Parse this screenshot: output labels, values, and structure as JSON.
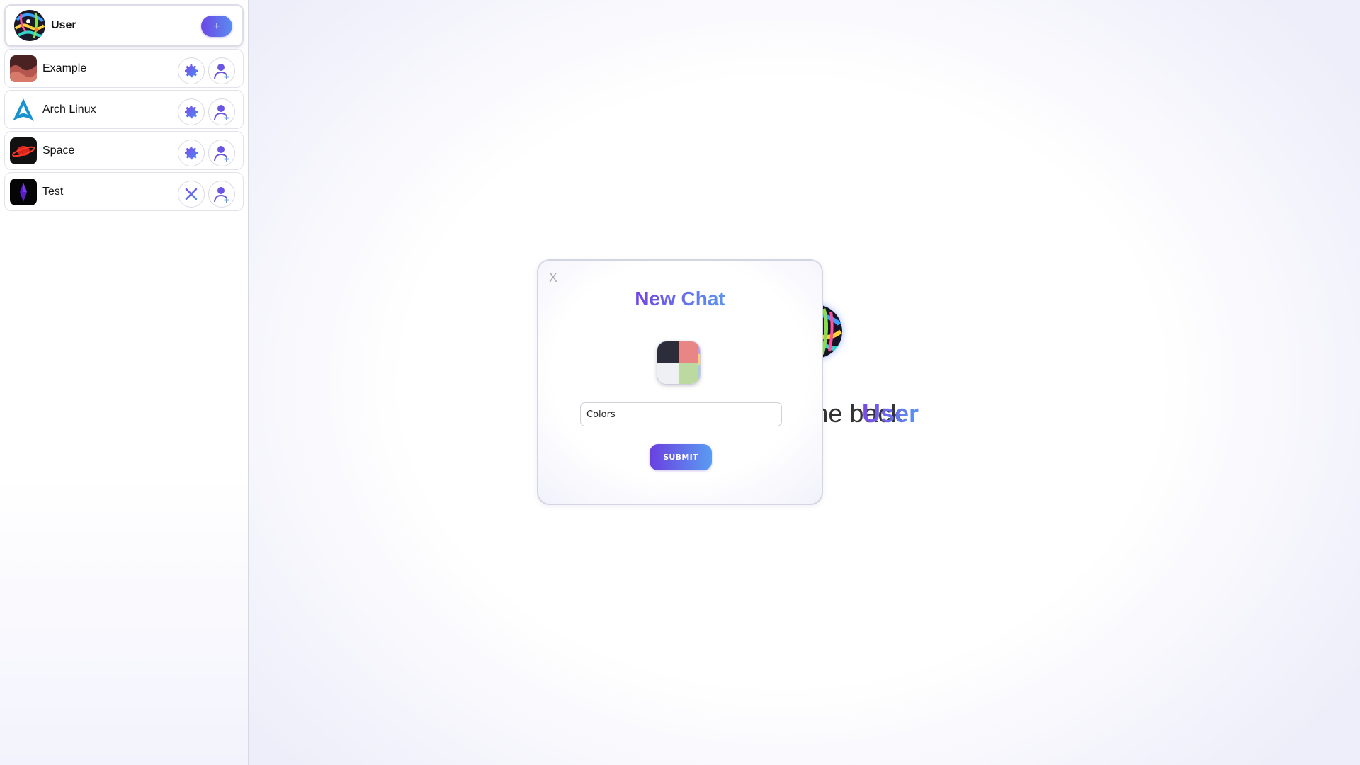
{
  "sidebar": {
    "user": {
      "name": "User",
      "add_label": "+",
      "avatar_icon": "user-avatar"
    },
    "chats": [
      {
        "name": "Example",
        "icon": "example-chat-icon",
        "action_a": "gear-icon",
        "action_b": "user-plus-icon"
      },
      {
        "name": "Arch Linux",
        "icon": "arch-linux-chat-icon",
        "action_a": "gear-icon",
        "action_b": "user-plus-icon"
      },
      {
        "name": "Space",
        "icon": "space-chat-icon",
        "action_a": "gear-icon",
        "action_b": "user-plus-icon"
      },
      {
        "name": "Test",
        "icon": "test-chat-icon",
        "action_a": "close-icon",
        "action_b": "user-plus-icon"
      }
    ]
  },
  "main": {
    "welcome_prefix": "Welcome back",
    "welcome_name": "User"
  },
  "modal": {
    "close_label": "X",
    "title": "New Chat",
    "name_value": "Colors",
    "submit_label": "SUBMIT"
  },
  "colors": {
    "accent_start": "#6a47e6",
    "accent_end": "#5a94ee",
    "icon_purple": "#6b56e3",
    "icon_blue": "#4c8cf0"
  }
}
